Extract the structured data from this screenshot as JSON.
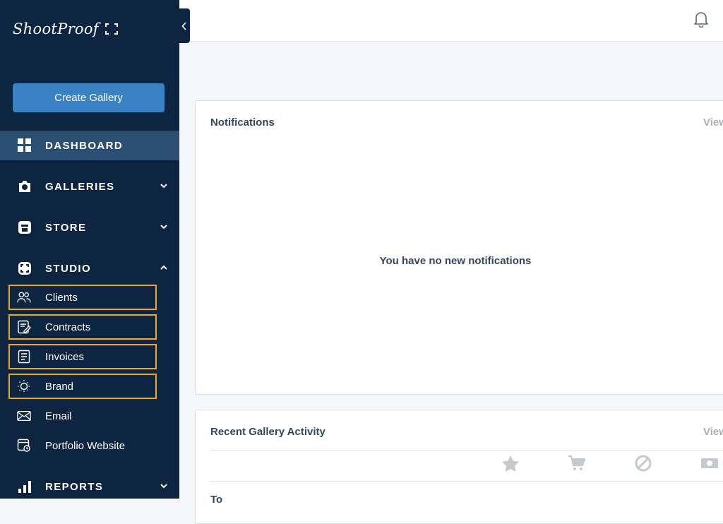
{
  "brand": {
    "name": "ShootProof"
  },
  "sidebar": {
    "create_label": "Create Gallery",
    "nav": {
      "dashboard": "DASHBOARD",
      "galleries": "GALLERIES",
      "store": "STORE",
      "studio": "STUDIO",
      "reports": "REPORTS"
    },
    "studio_items": {
      "clients": "Clients",
      "contracts": "Contracts",
      "invoices": "Invoices",
      "brand": "Brand",
      "email": "Email",
      "portfolio": "Portfolio Website"
    }
  },
  "notifications": {
    "title": "Notifications",
    "view_label": "View",
    "empty_message": "You have no new notifications"
  },
  "activity": {
    "title": "Recent Gallery Activity",
    "view_label": "View",
    "partial_row": "To"
  },
  "colors": {
    "sidebar_bg": "#0d2540",
    "active_nav": "#2b4f73",
    "primary_button": "#3a82c4",
    "highlight_outline": "#f1a820"
  }
}
